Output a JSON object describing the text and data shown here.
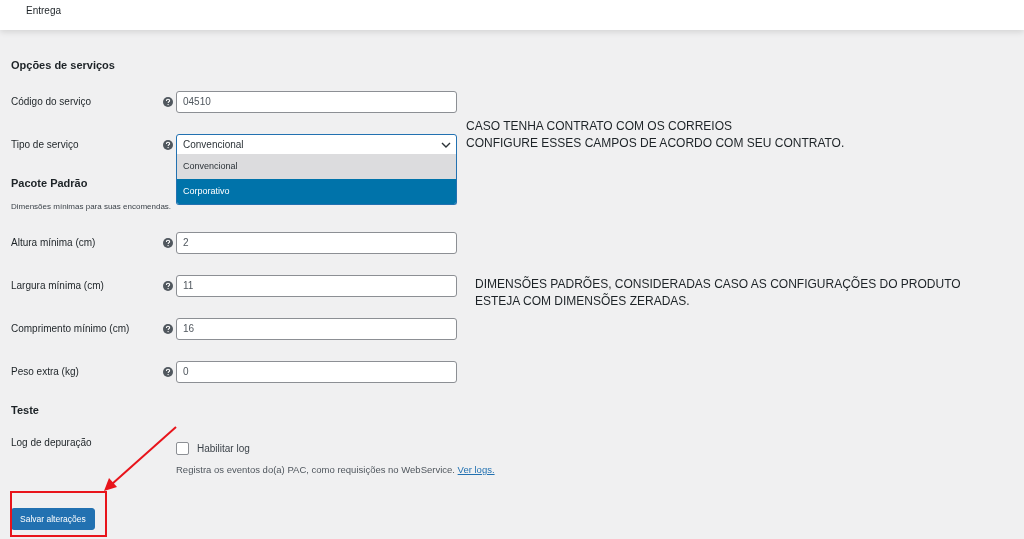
{
  "top_bar": {
    "title": "Entrega"
  },
  "sections": [
    {
      "heading": "Opções de serviços",
      "fields": [
        {
          "kind": "text",
          "label": "Código do serviço",
          "help": true,
          "value": "04510"
        },
        {
          "kind": "select",
          "label": "Tipo de serviço",
          "help": true,
          "value": "Convencional",
          "expanded": true,
          "options": [
            {
              "label": "Convencional",
              "selected": true,
              "highlighted": false
            },
            {
              "label": "Corporativo",
              "selected": false,
              "highlighted": true
            }
          ]
        }
      ]
    },
    {
      "heading": "Pacote Padrão",
      "description": "Dimensões mínimas para suas encomendas.",
      "fields": [
        {
          "kind": "text",
          "label": "Altura mínima (cm)",
          "help": true,
          "value": "2"
        },
        {
          "kind": "text",
          "label": "Largura mínima (cm)",
          "help": true,
          "value": "11"
        },
        {
          "kind": "text",
          "label": "Comprimento mínimo (cm)",
          "help": true,
          "value": "16"
        },
        {
          "kind": "text",
          "label": "Peso extra (kg)",
          "help": true,
          "value": "0"
        }
      ]
    },
    {
      "heading": "Teste",
      "fields": [
        {
          "kind": "checkbox",
          "label": "Log de depuração",
          "help": false,
          "option": "Habilitar log",
          "checked": false,
          "description": "Registra os eventos do(a) PAC, como requisições no WebService.",
          "link": "Ver logs."
        }
      ]
    }
  ],
  "save_button": "Salvar alterações",
  "annotations": [
    {
      "lines": [
        "CASO TENHA CONTRATO COM OS CORREIOS",
        "CONFIGURE ESSES CAMPOS DE ACORDO COM SEU CONTRATO."
      ]
    },
    {
      "lines": [
        "DIMENSÕES PADRÕES, CONSIDERADAS CASO AS CONFIGURAÇÕES DO PRODUTO",
        "ESTEJA COM DIMENSÕES ZERADAS."
      ]
    }
  ]
}
